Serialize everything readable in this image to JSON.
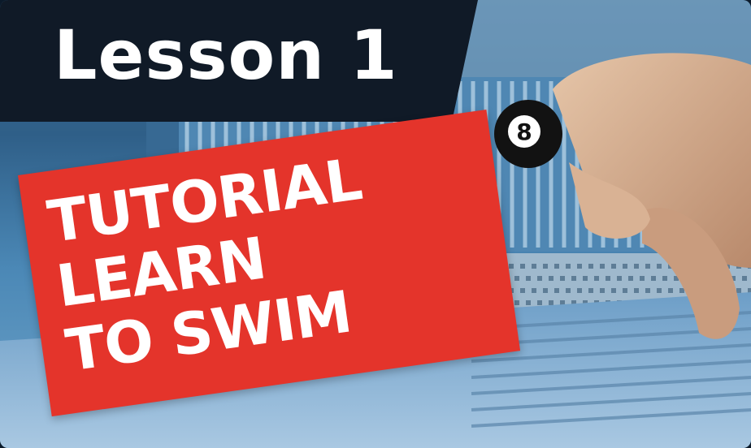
{
  "thumbnail": {
    "lesson_label": "Lesson 1",
    "headline_lines": [
      "TUTORIAL",
      "LEARN",
      "TO SWIM"
    ],
    "cap_number": "8"
  },
  "colors": {
    "banner": "#101a27",
    "headline_box": "#e4342b",
    "water": "#3e78a6",
    "text": "#ffffff"
  }
}
